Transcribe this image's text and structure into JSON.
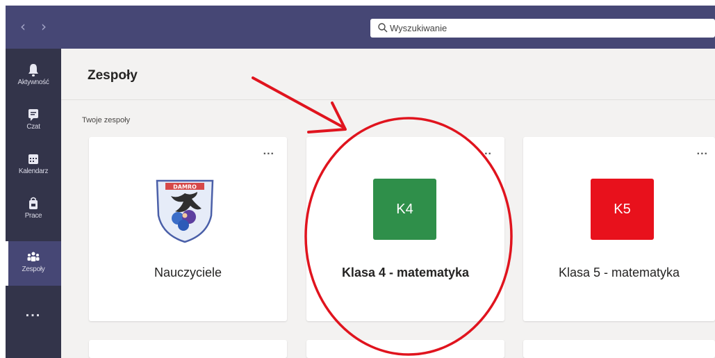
{
  "search": {
    "placeholder": "Wyszukiwanie"
  },
  "rail": {
    "items": [
      {
        "label": "Aktywność",
        "icon": "bell-icon"
      },
      {
        "label": "Czat",
        "icon": "chat-icon"
      },
      {
        "label": "Kalendarz",
        "icon": "calendar-icon"
      },
      {
        "label": "Prace",
        "icon": "assignments-icon"
      },
      {
        "label": "Zespoły",
        "icon": "teams-icon",
        "active": true
      }
    ],
    "more": "..."
  },
  "header": {
    "title": "Zespoły"
  },
  "section": {
    "label": "Twoje zespoły"
  },
  "teams": [
    {
      "name": "Nauczyciele",
      "logo_text": "DAMRO",
      "more": "..."
    },
    {
      "name": "Klasa 4 - matematyka",
      "avatar": "K4",
      "avatar_color": "#2f8f4a",
      "more": "..."
    },
    {
      "name": "Klasa 5 - matematyka",
      "avatar": "K5",
      "avatar_color": "#e8111c",
      "more": "..."
    }
  ],
  "colors": {
    "topbar": "#464775",
    "rail": "#33344a",
    "annotation": "#e0141e"
  }
}
